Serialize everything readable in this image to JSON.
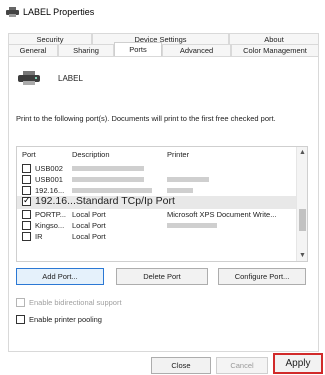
{
  "window": {
    "title": "LABEL Properties",
    "icon": "printer-icon"
  },
  "tabs": {
    "row1": [
      "Security",
      "Device Settings",
      "About"
    ],
    "row2": [
      "General",
      "Sharing",
      "Ports",
      "Advanced",
      "Color Management"
    ],
    "active": "Ports"
  },
  "printer": {
    "name": "LABEL"
  },
  "description": "Print to the following port(s). Documents will print to the first free checked port.",
  "ports_table": {
    "headers": {
      "port": "Port",
      "description": "Description",
      "printer": "Printer"
    },
    "rows": [
      {
        "port": "USB002",
        "description": "",
        "printer": "",
        "checked": false
      },
      {
        "port": "USB001",
        "description": "",
        "printer": "",
        "checked": false
      },
      {
        "port": "192.16...",
        "description": "",
        "printer": "",
        "checked": false
      },
      {
        "port": "192.16...Standard TCp/Ip Port",
        "description": "",
        "printer": "",
        "checked": true
      },
      {
        "port": "PORTP...",
        "description": "Local Port",
        "printer": "Microsoft XPS Document Write...",
        "checked": false
      },
      {
        "port": "Kingso...",
        "description": "Local Port",
        "printer": "",
        "checked": false
      },
      {
        "port": "IR",
        "description": "Local Port",
        "printer": "",
        "checked": false
      }
    ]
  },
  "buttons": {
    "add_port": "Add Port...",
    "delete_port": "Delete Port",
    "configure_port": "Configure Port...",
    "close": "Close",
    "cancel": "Cancel",
    "apply": "Apply"
  },
  "options": {
    "bidirectional": "Enable bidirectional support",
    "pooling": "Enable printer pooling"
  },
  "colors": {
    "focus_border": "#2b78d4",
    "highlight": "#d12a2a"
  }
}
